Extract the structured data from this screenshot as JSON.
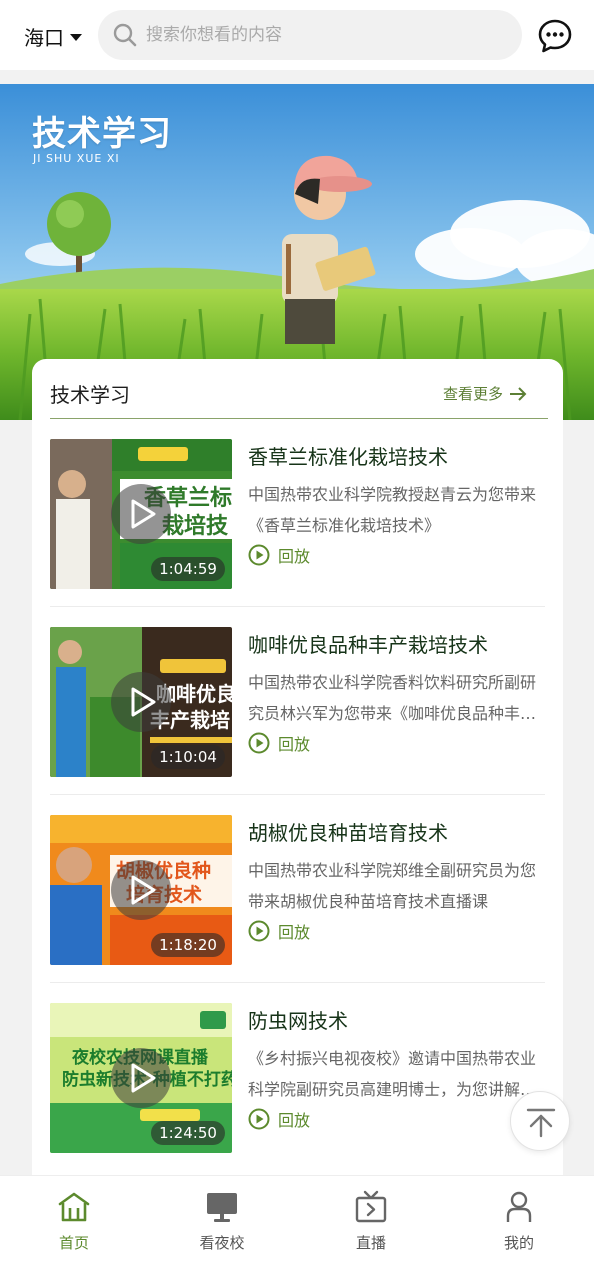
{
  "header": {
    "city": "海口",
    "search_placeholder": "搜索你想看的内容"
  },
  "banner": {
    "title": "技术学习",
    "subtitle": "JI SHU XUE XI"
  },
  "section": {
    "title": "技术学习",
    "more_label": "查看更多"
  },
  "videos": [
    {
      "title": "香草兰标准化栽培技术",
      "description": "中国热带农业科学院教授赵青云为您带来《香草兰标准化栽培技术》",
      "duration": "1:04:59",
      "replay_label": "回放",
      "thumb_caption": "香草兰标准 栽培技术"
    },
    {
      "title": "咖啡优良品种丰产栽培技术",
      "description": "中国热带农业科学院香料饮料研究所副研究员林兴军为您带来《咖啡优良品种丰产栽培技术》",
      "duration": "1:10:04",
      "replay_label": "回放",
      "thumb_caption": "咖啡优良 丰产栽培"
    },
    {
      "title": "胡椒优良种苗培育技术",
      "description": "中国热带农业科学院郑维全副研究员为您带来胡椒优良种苗培育技术直播课",
      "duration": "1:18:20",
      "replay_label": "回放",
      "thumb_caption": "胡椒优良种 培育技术"
    },
    {
      "title": "防虫网技术",
      "description": "《乡村振兴电视夜校》邀请中国热带农业科学院副研究员高建明博士，为您讲解防虫网技术",
      "duration": "1:24:50",
      "replay_label": "回放",
      "thumb_caption": "夜校农技网课直播 防虫新技术 种植不打药"
    }
  ],
  "bottom_nav": [
    {
      "label": "首页",
      "icon": "home-icon",
      "active": true
    },
    {
      "label": "看夜校",
      "icon": "monitor-icon",
      "active": false
    },
    {
      "label": "直播",
      "icon": "tv-play-icon",
      "active": false
    },
    {
      "label": "我的",
      "icon": "user-icon",
      "active": false
    }
  ],
  "colors": {
    "accent": "#5c8a2d",
    "title_dark": "#163318"
  }
}
